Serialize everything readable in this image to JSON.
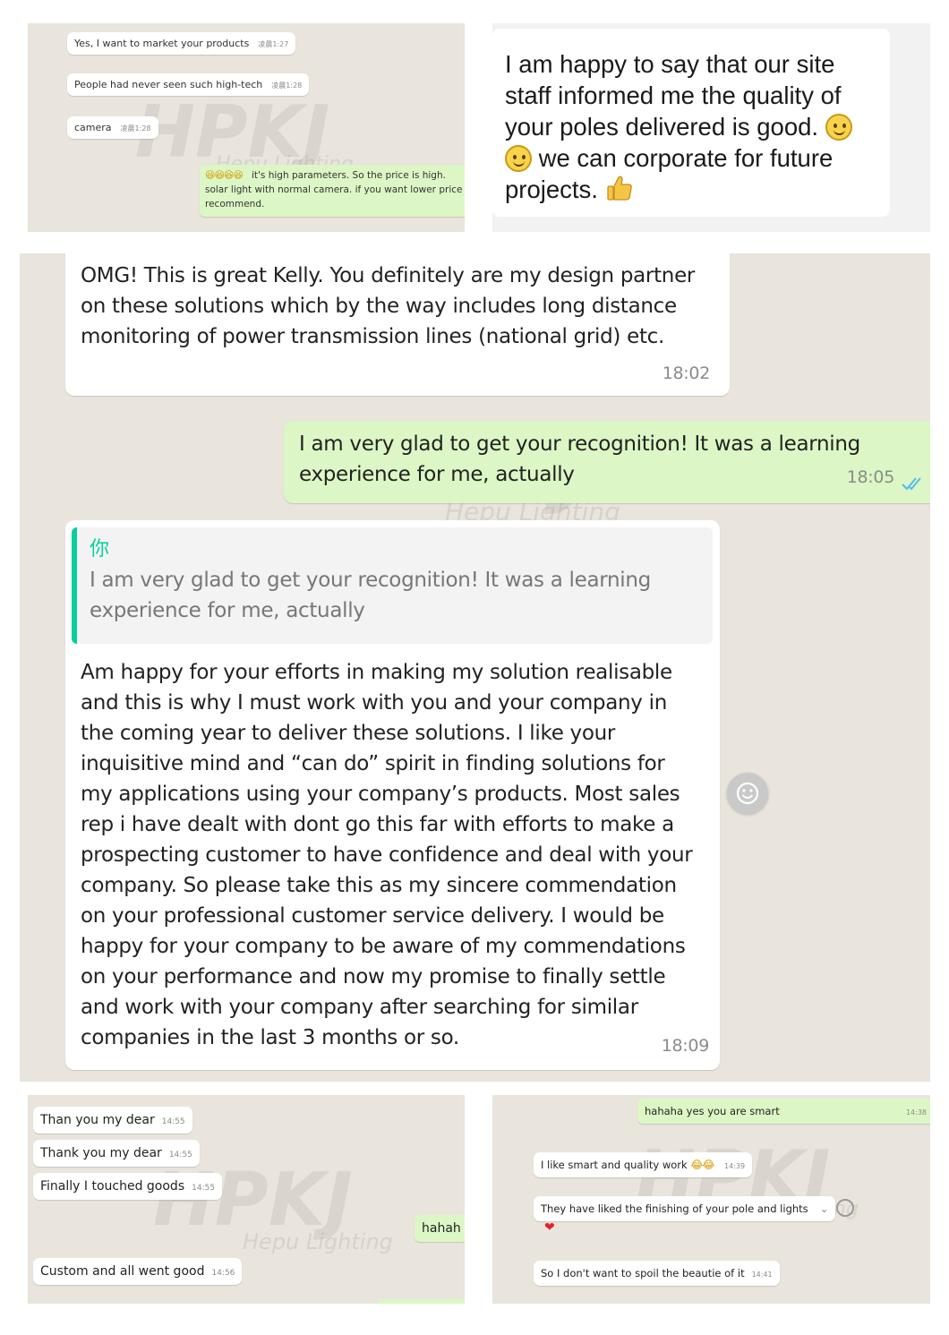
{
  "panel_top_left": {
    "messages": [
      {
        "text": "Yes, I want to market your products",
        "time": "凌晨1:27"
      },
      {
        "text": "People had never seen such high-tech",
        "time": "凌晨1:28"
      },
      {
        "text": "camera",
        "time": "凌晨1:28"
      }
    ],
    "reply": {
      "line1": "it's high parameters. So the price is high.",
      "line2": "solar light with normal camera. if you want lower price",
      "line3": "recommend."
    }
  },
  "panel_top_right": {
    "part1": "I am happy to say that our site staff informed me the quality of your poles delivered is good.",
    "part2": "we can corporate for future projects."
  },
  "panel_main": {
    "msg1": {
      "lines": [
        "OMG! This is great Kelly. You definitely are my design partner",
        "on these solutions which by the way includes long distance",
        "monitoring of power transmission lines (national grid) etc."
      ],
      "time": "18:02"
    },
    "msg2": {
      "lines": [
        "I am very glad to get your recognition! It was a learning",
        "experience for me, actually"
      ],
      "time": "18:05"
    },
    "msg3": {
      "quote_author": "你",
      "quote_lines": [
        "I am very glad to get your recognition! It was a learning",
        "experience for me, actually"
      ],
      "lines": [
        "Am happy for your efforts in making my solution realisable",
        "and this is why I must work with you and your company in",
        "the coming year to deliver these solutions. I like your",
        "inquisitive mind and “can do” spirit in finding solutions for",
        "my applications using your company’s products. Most sales",
        "rep i have dealt with dont go this far with efforts to make a",
        "prospecting customer to have confidence and deal with your",
        "company. So please take this as my sincere commendation",
        "on your professional customer service delivery. I would be",
        "happy for your company to be aware of my commendations",
        "on your performance and now my promise to finally settle",
        "and work with your company after searching for similar",
        "companies in the last 3 months or so."
      ],
      "time": "18:09"
    }
  },
  "panel_bottom_left": {
    "messages": [
      {
        "text": "Than you my dear",
        "time": "14:55"
      },
      {
        "text": "Thank you my dear",
        "time": "14:55"
      },
      {
        "text": "Finally I touched goods",
        "time": "14:55"
      },
      {
        "text": "Custom and all went good",
        "time": "14:56"
      }
    ],
    "reply": "hahah"
  },
  "panel_bottom_right": {
    "sent": {
      "text": "hahaha  yes  you are smart",
      "time": "14:38"
    },
    "messages": [
      {
        "text": "I like smart and quality work",
        "time": "14:39"
      },
      {
        "text": "They have liked the finishing of your pole and lights",
        "time": ""
      },
      {
        "text": "So I don't want to spoil the beautie of it",
        "time": "14:41"
      }
    ]
  },
  "watermark": {
    "brand": "HPKJ",
    "sub": "Hepu Lighting"
  },
  "colors": {
    "outgoing_bubble": "#dcf7c5",
    "incoming_bubble": "#ffffff",
    "chat_bg": "#e9e4dc",
    "quote_bar": "#06cf9c",
    "read_ticks": "#53bdeb"
  }
}
